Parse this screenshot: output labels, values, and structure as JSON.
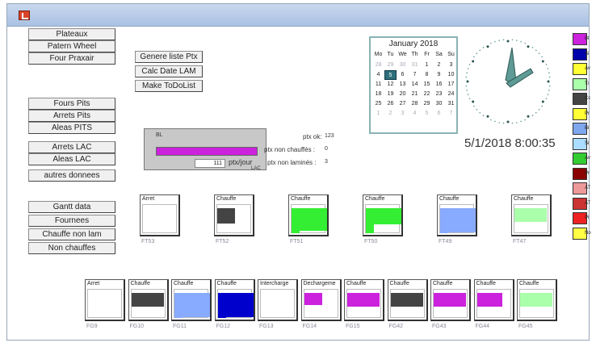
{
  "buttons": {
    "plateaux": "Plateaux",
    "patern_wheel": "Patern Wheel",
    "four_praxair": "Four Praxair",
    "fours_pits": "Fours Pits",
    "arrets_pits": "Arrets Pits",
    "aleas_pits": "Aleas PITS",
    "arrets_lac": "Arrets LAC",
    "aleas_lac": "Aleas LAC",
    "autres_donnees": "autres donnees",
    "gantt_data": "Gantt data",
    "fournees": "Fournees",
    "chauffe_non_lam": "Chauffe non lam",
    "non_chauffes": "Non chauffes",
    "genere_liste": "Genere liste Ptx",
    "calc_date_lam": "Calc Date LAM",
    "make_todolist": "Make ToDoList"
  },
  "calendar": {
    "title": "January 2018",
    "weekdays": [
      "Mo",
      "Tu",
      "We",
      "Th",
      "Fr",
      "Sa",
      "Su"
    ],
    "days": [
      {
        "d": "28",
        "dim": true
      },
      {
        "d": "29",
        "dim": true
      },
      {
        "d": "30",
        "dim": true
      },
      {
        "d": "31",
        "dim": true
      },
      {
        "d": "1"
      },
      {
        "d": "2"
      },
      {
        "d": "3"
      },
      {
        "d": "4"
      },
      {
        "d": "5",
        "sel": true
      },
      {
        "d": "6"
      },
      {
        "d": "7"
      },
      {
        "d": "8"
      },
      {
        "d": "9"
      },
      {
        "d": "10"
      },
      {
        "d": "11"
      },
      {
        "d": "12"
      },
      {
        "d": "13"
      },
      {
        "d": "14"
      },
      {
        "d": "15"
      },
      {
        "d": "16"
      },
      {
        "d": "17"
      },
      {
        "d": "18"
      },
      {
        "d": "19"
      },
      {
        "d": "20"
      },
      {
        "d": "21"
      },
      {
        "d": "22"
      },
      {
        "d": "23"
      },
      {
        "d": "24"
      },
      {
        "d": "25"
      },
      {
        "d": "26"
      },
      {
        "d": "27"
      },
      {
        "d": "28"
      },
      {
        "d": "29"
      },
      {
        "d": "30"
      },
      {
        "d": "31"
      },
      {
        "d": "1",
        "dim": true
      },
      {
        "d": "2",
        "dim": true
      },
      {
        "d": "3",
        "dim": true
      },
      {
        "d": "4",
        "dim": true
      },
      {
        "d": "5",
        "dim": true
      },
      {
        "d": "6",
        "dim": true
      },
      {
        "d": "7",
        "dim": true
      }
    ]
  },
  "datetime": "5/1/2018 8:00:35",
  "lam": {
    "label": "BL",
    "value": "111",
    "unit": "ptx/jour",
    "sublabel": "LAC"
  },
  "stats": {
    "ptx_ok_label": "ptx ok:",
    "ptx_ok_value": "123",
    "non_chauffes_label": "ptx non chauffés :",
    "non_chauffes_value": "0",
    "non_lamines_label": "ptx non laminés :",
    "non_lamines_value": "3"
  },
  "legend": [
    {
      "label": "Bl",
      "color": "#cc22dd"
    },
    {
      "label": "Si",
      "color": "#0000aa"
    },
    {
      "label": "Av",
      "color": "#ffff33"
    },
    {
      "label": "Ti",
      "color": "#aaffaa"
    },
    {
      "label": "Cc",
      "color": "#444444"
    },
    {
      "label": "Pr",
      "color": "#ffff33"
    },
    {
      "label": "Bi",
      "color": "#7fa7ee"
    },
    {
      "label": "Si",
      "color": "#aaddff"
    },
    {
      "label": "Av",
      "color": "#33cc33"
    },
    {
      "label": "Pr",
      "color": "#8b0000"
    },
    {
      "label": "AT",
      "color": "#ee9999"
    },
    {
      "label": "AT",
      "color": "#cc3333"
    },
    {
      "label": "Pi",
      "color": "#ee2222"
    },
    {
      "label": "No",
      "color": "#ffff44"
    }
  ],
  "furnaces_top": [
    {
      "state": "Arret",
      "name": "FT53",
      "fill": null
    },
    {
      "state": "Chauffe",
      "name": "FT52",
      "fill": {
        "color": "#444444",
        "w": 0.5,
        "h": 0.5
      }
    },
    {
      "state": "Chauffe",
      "name": "FT51",
      "fill": {
        "color": "#33ee33",
        "w": 1.0,
        "h": 0.75,
        "step": true
      }
    },
    {
      "state": "Chauffe",
      "name": "FT50",
      "fill": {
        "color": "#33ee33",
        "w": 1.0,
        "h": 0.55,
        "step": true
      }
    },
    {
      "state": "Chauffe",
      "name": "FT49",
      "fill": {
        "color": "#88aaff",
        "w": 1.0,
        "h": 0.8,
        "step": true
      }
    },
    {
      "state": "Chauffe",
      "name": "FT47",
      "fill": {
        "color": "#aaffaa",
        "w": 0.9,
        "h": 0.45
      }
    }
  ],
  "furnaces_bottom": [
    {
      "state": "Arret",
      "name": "FG9",
      "fill": null
    },
    {
      "state": "Chauffe",
      "name": "FG10",
      "fill": {
        "color": "#444444",
        "w": 0.9,
        "h": 0.45
      }
    },
    {
      "state": "Chauffe",
      "name": "FG11",
      "fill": {
        "color": "#88aaff",
        "w": 1.0,
        "h": 0.8,
        "step": true
      }
    },
    {
      "state": "Chauffe",
      "name": "FG12",
      "fill": {
        "color": "#0000cc",
        "w": 1.0,
        "h": 0.8,
        "step": true
      }
    },
    {
      "state": "Intercharge",
      "name": "FG13",
      "fill": null
    },
    {
      "state": "Dechargeme",
      "name": "FG14",
      "fill": {
        "color": "#cc22dd",
        "w": 0.5,
        "h": 0.4
      }
    },
    {
      "state": "Chauffe",
      "name": "FG15",
      "fill": {
        "color": "#cc22dd",
        "w": 0.9,
        "h": 0.45
      }
    },
    {
      "state": "Chauffe",
      "name": "FG42",
      "fill": {
        "color": "#444444",
        "w": 0.9,
        "h": 0.45
      }
    },
    {
      "state": "Chauffe",
      "name": "FG43",
      "fill": {
        "color": "#cc22dd",
        "w": 0.9,
        "h": 0.45
      }
    },
    {
      "state": "Chauffe",
      "name": "FG44",
      "fill": {
        "color": "#cc22dd",
        "w": 0.7,
        "h": 0.45
      }
    },
    {
      "state": "Chauffe",
      "name": "FG45",
      "fill": {
        "color": "#aaffaa",
        "w": 0.9,
        "h": 0.45
      }
    }
  ]
}
